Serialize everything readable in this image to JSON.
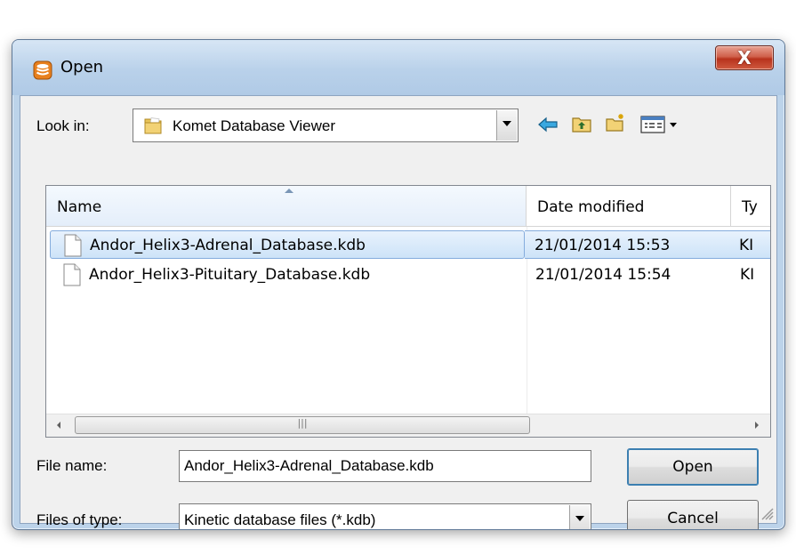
{
  "dialog": {
    "title": "Open",
    "close_label": "X"
  },
  "look_in": {
    "label": "Look in:",
    "value": "Komet Database Viewer"
  },
  "toolbar": {
    "icons": [
      "back-arrow-icon",
      "up-folder-icon",
      "new-folder-icon",
      "view-menu-icon"
    ]
  },
  "filelist": {
    "columns": [
      "Name",
      "Date modified",
      "Ty"
    ],
    "rows": [
      {
        "name": "Andor_Helix3-Adrenal_Database.kdb",
        "date": "21/01/2014 15:53",
        "type": "KI",
        "selected": true
      },
      {
        "name": "Andor_Helix3-Pituitary_Database.kdb",
        "date": "21/01/2014 15:54",
        "type": "KI",
        "selected": false
      }
    ]
  },
  "file_name": {
    "label": "File name:",
    "value": "Andor_Helix3-Adrenal_Database.kdb"
  },
  "files_of_type": {
    "label": "Files of type:",
    "value": "Kinetic database files (*.kdb)"
  },
  "buttons": {
    "open_label": "Open",
    "cancel_label": "Cancel"
  },
  "colors": {
    "selection": "#cde3f8",
    "frame": "#bcd3ea",
    "close": "#c8422b"
  }
}
